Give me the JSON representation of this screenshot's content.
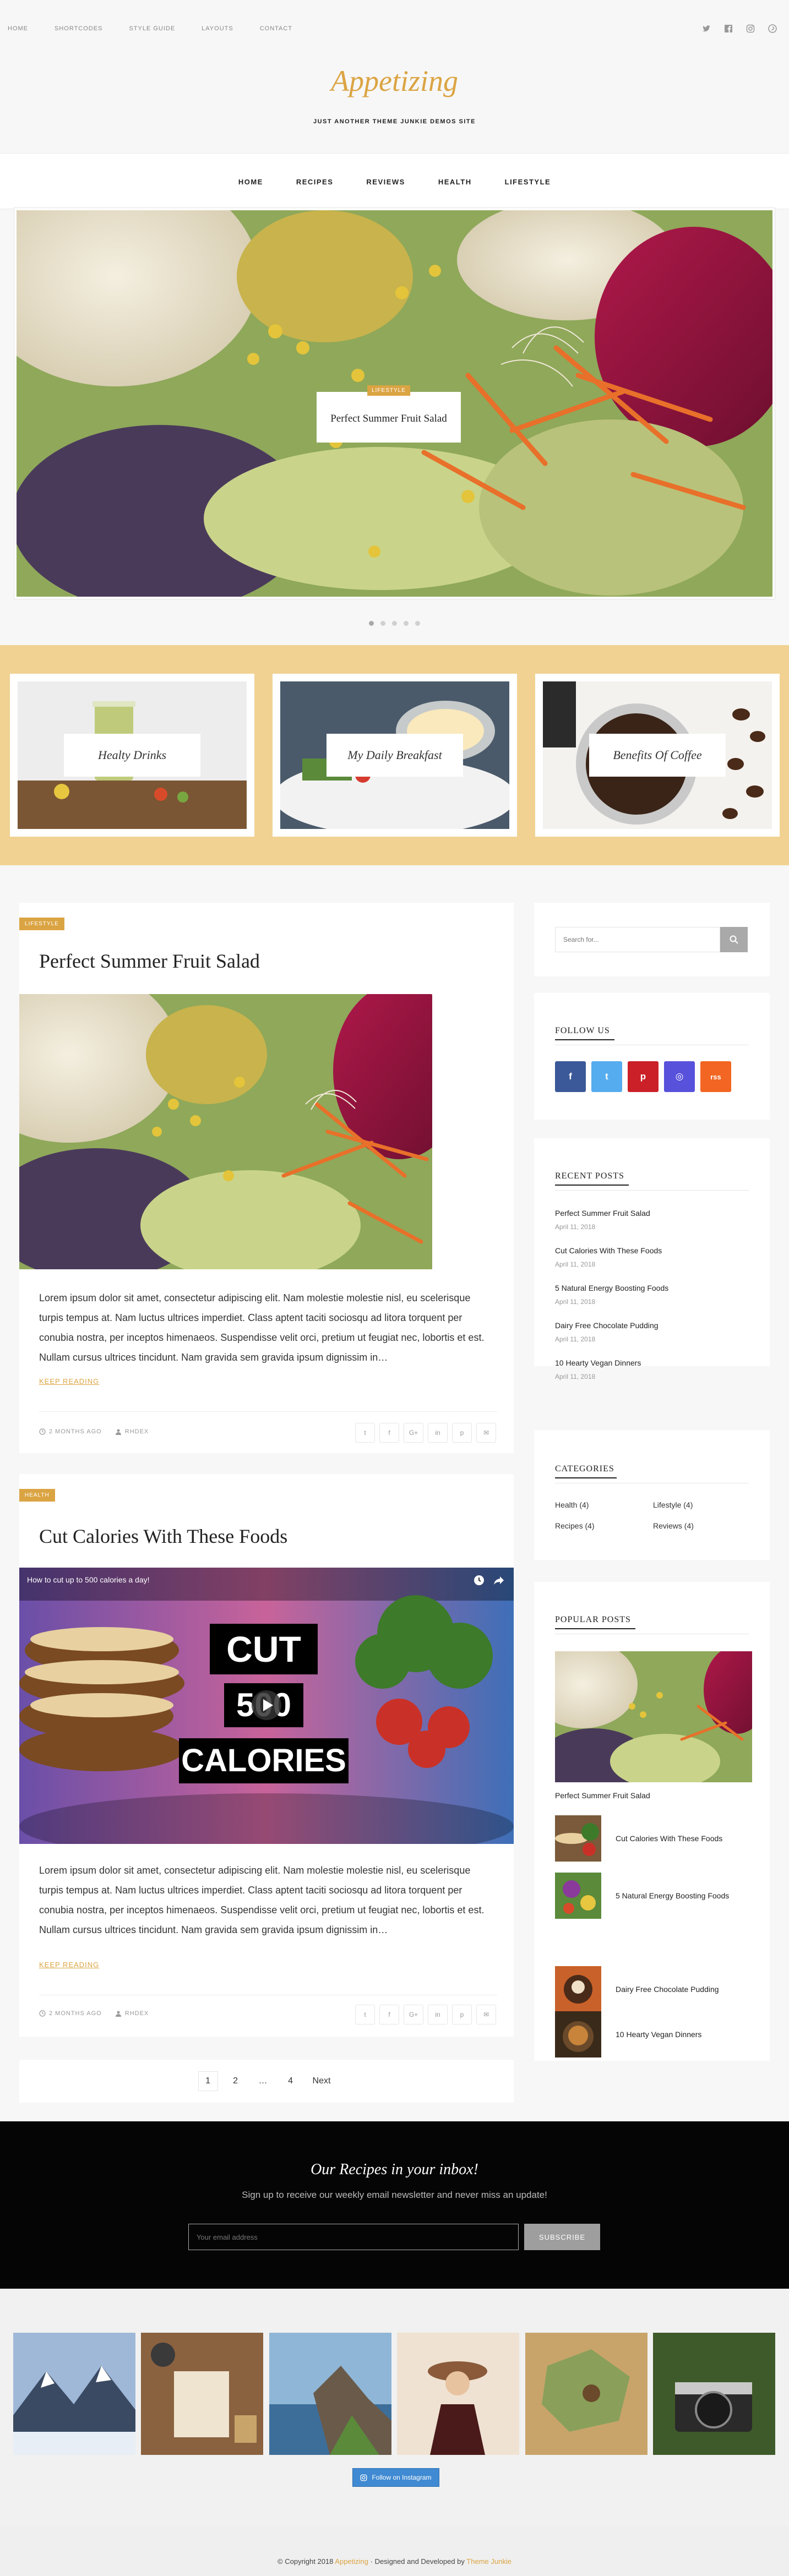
{
  "topbar": {
    "nav": [
      "HOME",
      "SHORTCODES",
      "STYLE GUIDE",
      "LAYOUTS",
      "CONTACT"
    ],
    "social_icons": [
      "twitter-icon",
      "facebook-icon",
      "instagram-icon",
      "pinterest-icon"
    ]
  },
  "site": {
    "title": "Appetizing",
    "tagline": "JUST ANOTHER THEME JUNKIE DEMOS SITE"
  },
  "main_nav": [
    "HOME",
    "RECIPES",
    "REVIEWS",
    "HEALTH",
    "LIFESTYLE"
  ],
  "slider": {
    "category": "LIFESTYLE",
    "title": "Perfect Summer Fruit Salad",
    "slide_count": 5,
    "active_slide": 1
  },
  "promos": [
    "Healty Drinks",
    "My Daily Breakfast",
    "Benefits Of Coffee"
  ],
  "posts": [
    {
      "category": "LIFESTYLE",
      "title": "Perfect Summer Fruit Salad",
      "excerpt": "Lorem ipsum dolor sit amet, consectetur adipiscing elit. Nam molestie molestie nisl, eu scelerisque turpis tempus at. Nam luctus ultrices imperdiet. Class aptent taciti sociosqu ad litora torquent per conubia nostra, per inceptos himenaeos. Suspendisse velit orci, pretium ut feugiat nec, lobortis et est. Nullam cursus ultrices tincidunt. Nam gravida sem gravida ipsum dignissim in…",
      "read_more": "KEEP READING",
      "time": "2 MONTHS AGO",
      "author": "RHDEX",
      "share": [
        "t",
        "f",
        "G+",
        "in",
        "p",
        "✉"
      ]
    },
    {
      "category": "HEALTH",
      "title": "Cut Calories With These Foods",
      "video_title": "How to cut up to 500 calories a day!",
      "video_text": [
        "CUT",
        "500",
        "CALORIES"
      ],
      "excerpt": "Lorem ipsum dolor sit amet, consectetur adipiscing elit. Nam molestie molestie nisl, eu scelerisque turpis tempus at. Nam luctus ultrices imperdiet. Class aptent taciti sociosqu ad litora torquent per conubia nostra, per inceptos himenaeos. Suspendisse velit orci, pretium ut feugiat nec, lobortis et est. Nullam cursus ultrices tincidunt. Nam gravida sem gravida ipsum dignissim in…",
      "read_more": "KEEP READING",
      "time": "2 MONTHS AGO",
      "author": "RHDEX",
      "share": [
        "t",
        "f",
        "G+",
        "in",
        "p",
        "✉"
      ]
    }
  ],
  "pagination": [
    "1",
    "2",
    "…",
    "4",
    "Next"
  ],
  "sidebar": {
    "search_placeholder": "Search for...",
    "follow_title": "FOLLOW US",
    "follow_buttons": [
      {
        "label": "f",
        "color": "#3b5998"
      },
      {
        "label": "t",
        "color": "#55acee"
      },
      {
        "label": "p",
        "color": "#cb2027"
      },
      {
        "label": "◎",
        "color": "#5851db"
      },
      {
        "label": "rss",
        "color": "#f26522"
      }
    ],
    "recent_title": "RECENT POSTS",
    "recent": [
      {
        "title": "Perfect Summer Fruit Salad",
        "date": "April 11, 2018"
      },
      {
        "title": "Cut Calories With These Foods",
        "date": "April 11, 2018"
      },
      {
        "title": "5 Natural Energy Boosting Foods",
        "date": "April 11, 2018"
      },
      {
        "title": "Dairy Free Chocolate Pudding",
        "date": "April 11, 2018"
      },
      {
        "title": "10 Hearty Vegan Dinners",
        "date": "April 11, 2018"
      }
    ],
    "categories_title": "CATEGORIES",
    "categories": [
      "Health (4)",
      "Lifestyle (4)",
      "Recipes (4)",
      "Reviews (4)"
    ],
    "popular_title": "POPULAR POSTS",
    "popular_featured": "Perfect Summer Fruit Salad",
    "popular": [
      "Cut Calories With These Foods",
      "5 Natural Energy Boosting Foods",
      "Dairy Free Chocolate Pudding",
      "10 Hearty Vegan Dinners"
    ]
  },
  "newsletter": {
    "title": "Our Recipes in your inbox!",
    "subtitle": "Sign up to receive our weekly email newsletter and never miss an update!",
    "placeholder": "Your email address",
    "button": "SUBSCRIBE"
  },
  "instagram": {
    "follow_label": "Follow on Instagram"
  },
  "footer": {
    "prefix": "© Copyright 2018",
    "site": "Appetizing",
    "middle": " · Designed and Developed by ",
    "developer": "Theme Junkie"
  },
  "colors": {
    "accent": "#dba443",
    "promo_band": "#f1d292",
    "newsletter_bg": "#050505"
  }
}
